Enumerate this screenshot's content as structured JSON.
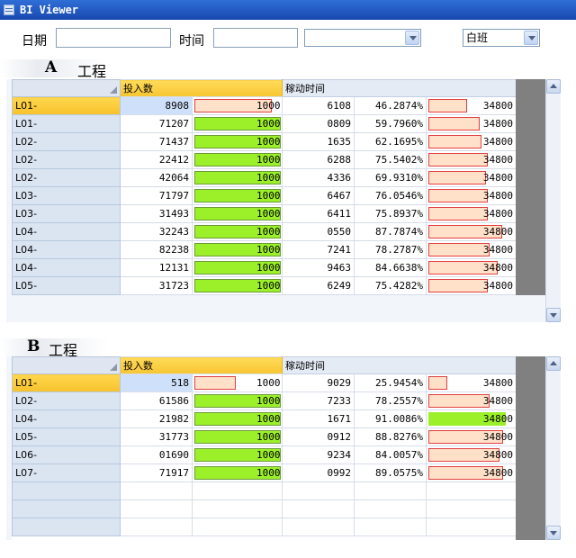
{
  "window": {
    "title": "BI Viewer"
  },
  "toolbar": {
    "date_label": "日期",
    "date_value": "",
    "time_label": "时间",
    "time_value": "",
    "combo1_value": "",
    "shift_value": "白班"
  },
  "sections": [
    {
      "code": "A",
      "name": "工程",
      "headers": {
        "input": "投入数",
        "operation": "稼动时间"
      },
      "rows": [
        {
          "line": "L01-",
          "input": "8908",
          "target": "1000",
          "target_fill": 0.9,
          "target_color": "peach",
          "op": "6108",
          "pct": "46.2874%",
          "cap": "34800",
          "cap_fill": 0.5,
          "cap_color": "peach",
          "selected": true
        },
        {
          "line": "L01-",
          "input": "71207",
          "target": "1000",
          "target_fill": 1.0,
          "target_color": "green",
          "op": "0809",
          "pct": "59.7960%",
          "cap": "34800",
          "cap_fill": 0.66,
          "cap_color": "peach"
        },
        {
          "line": "L02-",
          "input": "71437",
          "target": "1000",
          "target_fill": 1.0,
          "target_color": "green",
          "op": "1635",
          "pct": "62.1695%",
          "cap": "34800",
          "cap_fill": 0.69,
          "cap_color": "peach"
        },
        {
          "line": "L02-",
          "input": "22412",
          "target": "1000",
          "target_fill": 1.0,
          "target_color": "green",
          "op": "6288",
          "pct": "75.5402%",
          "cap": "34800",
          "cap_fill": 0.77,
          "cap_color": "peach"
        },
        {
          "line": "L02-",
          "input": "42064",
          "target": "1000",
          "target_fill": 1.0,
          "target_color": "green",
          "op": "4336",
          "pct": "69.9310%",
          "cap": "34800",
          "cap_fill": 0.74,
          "cap_color": "peach"
        },
        {
          "line": "L03-",
          "input": "71797",
          "target": "1000",
          "target_fill": 1.0,
          "target_color": "green",
          "op": "6467",
          "pct": "76.0546%",
          "cap": "34800",
          "cap_fill": 0.77,
          "cap_color": "peach"
        },
        {
          "line": "L03-",
          "input": "31493",
          "target": "1000",
          "target_fill": 1.0,
          "target_color": "green",
          "op": "6411",
          "pct": "75.8937%",
          "cap": "34800",
          "cap_fill": 0.77,
          "cap_color": "peach"
        },
        {
          "line": "L04-",
          "input": "32243",
          "target": "1000",
          "target_fill": 1.0,
          "target_color": "green",
          "op": "0550",
          "pct": "87.7874%",
          "cap": "34800",
          "cap_fill": 0.95,
          "cap_color": "peach"
        },
        {
          "line": "L04-",
          "input": "82238",
          "target": "1000",
          "target_fill": 1.0,
          "target_color": "green",
          "op": "7241",
          "pct": "78.2787%",
          "cap": "34800",
          "cap_fill": 0.79,
          "cap_color": "peach"
        },
        {
          "line": "L04-",
          "input": "12131",
          "target": "1000",
          "target_fill": 1.0,
          "target_color": "green",
          "op": "9463",
          "pct": "84.6638%",
          "cap": "34800",
          "cap_fill": 0.9,
          "cap_color": "peach"
        },
        {
          "line": "L05-",
          "input": "31723",
          "target": "1000",
          "target_fill": 1.0,
          "target_color": "green",
          "op": "6249",
          "pct": "75.4282%",
          "cap": "34800",
          "cap_fill": 0.77,
          "cap_color": "peach"
        }
      ]
    },
    {
      "code": "B",
      "name": "工程",
      "headers": {
        "input": "投入数",
        "operation": "稼动时间"
      },
      "rows": [
        {
          "line": "L01-",
          "input": "518",
          "target": "1000",
          "target_fill": 0.48,
          "target_color": "peach",
          "op": "9029",
          "pct": "25.9454%",
          "cap": "34800",
          "cap_fill": 0.24,
          "cap_color": "peach",
          "selected": true
        },
        {
          "line": "L02-",
          "input": "61586",
          "target": "1000",
          "target_fill": 1.0,
          "target_color": "green",
          "op": "7233",
          "pct": "78.2557%",
          "cap": "34800",
          "cap_fill": 0.79,
          "cap_color": "peach"
        },
        {
          "line": "L04-",
          "input": "21982",
          "target": "1000",
          "target_fill": 1.0,
          "target_color": "green",
          "op": "1671",
          "pct": "91.0086%",
          "cap": "34800",
          "cap_fill": 1.0,
          "cap_color": "green"
        },
        {
          "line": "L05-",
          "input": "31773",
          "target": "1000",
          "target_fill": 1.0,
          "target_color": "green",
          "op": "0912",
          "pct": "88.8276%",
          "cap": "34800",
          "cap_fill": 0.97,
          "cap_color": "peach"
        },
        {
          "line": "L06-",
          "input": "01690",
          "target": "1000",
          "target_fill": 1.0,
          "target_color": "green",
          "op": "9234",
          "pct": "84.0057%",
          "cap": "34800",
          "cap_fill": 0.92,
          "cap_color": "peach"
        },
        {
          "line": "L07-",
          "input": "71917",
          "target": "1000",
          "target_fill": 1.0,
          "target_color": "green",
          "op": "0992",
          "pct": "89.0575%",
          "cap": "34800",
          "cap_fill": 0.97,
          "cap_color": "peach"
        }
      ],
      "empty_rows": 3
    }
  ],
  "colors": {
    "header": "#ffd23c",
    "green_bar": "#9cf02a",
    "peach_bar": "#ffe0c8",
    "bar_border": "#e04040"
  }
}
